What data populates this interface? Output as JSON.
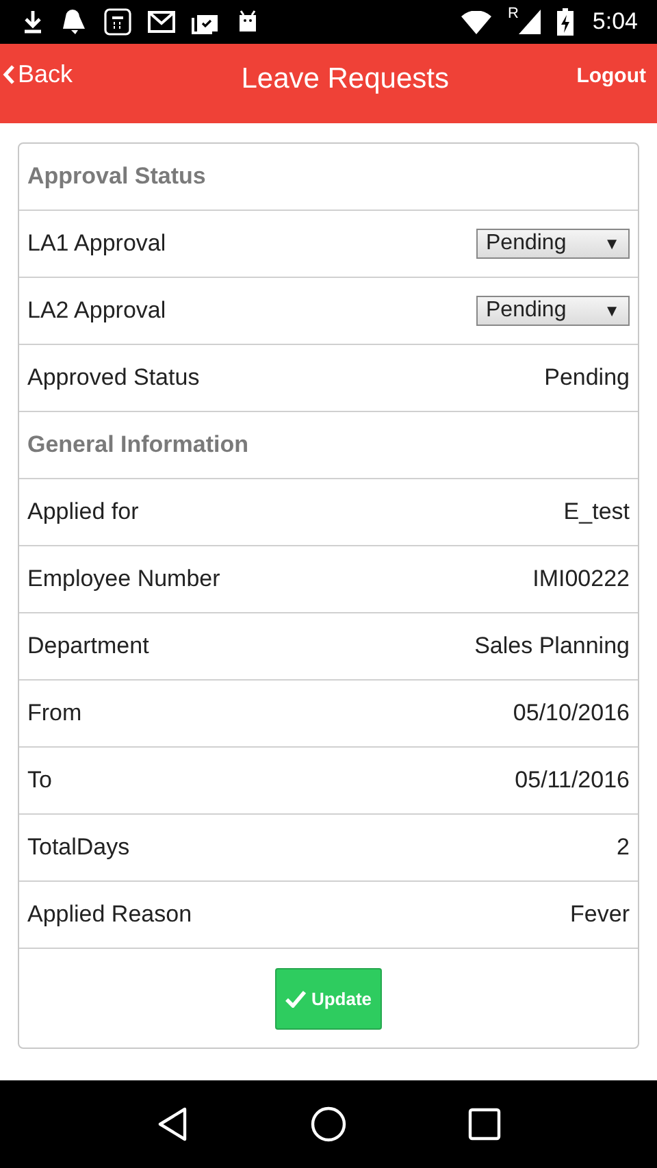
{
  "status_bar": {
    "time": "5:04",
    "roaming": "R"
  },
  "header": {
    "back": "Back",
    "title": "Leave Requests",
    "logout": "Logout"
  },
  "rows": [
    {
      "kind": "section",
      "label": "Approval Status"
    },
    {
      "kind": "select",
      "label": "LA1 Approval",
      "value": "Pending",
      "arrow": "▼"
    },
    {
      "kind": "select",
      "label": "LA2 Approval",
      "value": "Pending",
      "arrow": "▼"
    },
    {
      "kind": "text",
      "label": "Approved Status",
      "value": "Pending"
    },
    {
      "kind": "section",
      "label": "General Information"
    },
    {
      "kind": "text",
      "label": "Applied for",
      "value": "E_test"
    },
    {
      "kind": "text",
      "label": "Employee Number",
      "value": "IMI00222"
    },
    {
      "kind": "text",
      "label": "Department",
      "value": "Sales Planning"
    },
    {
      "kind": "text",
      "label": "From",
      "value": "05/10/2016"
    },
    {
      "kind": "text",
      "label": "To",
      "value": "05/11/2016"
    },
    {
      "kind": "text",
      "label": "TotalDays",
      "value": "2"
    },
    {
      "kind": "text",
      "label": "Applied Reason",
      "value": "Fever"
    }
  ],
  "button": "Update"
}
